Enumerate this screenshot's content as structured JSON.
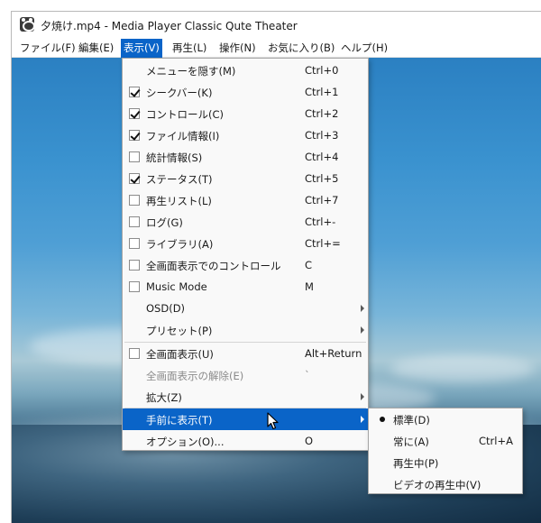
{
  "window": {
    "title": "夕焼け.mp4 - Media Player Classic Qute Theater"
  },
  "menubar": [
    {
      "label": "ファイル(F)",
      "name": "menu-file"
    },
    {
      "label": "編集(E)",
      "name": "menu-edit"
    },
    {
      "label": "表示(V)",
      "name": "menu-view"
    },
    {
      "label": "再生(L)",
      "name": "menu-play"
    },
    {
      "label": "操作(N)",
      "name": "menu-navigate"
    },
    {
      "label": "お気に入り(B)",
      "name": "menu-favorites"
    },
    {
      "label": "ヘルプ(H)",
      "name": "menu-help"
    }
  ],
  "view_menu": {
    "items": [
      {
        "label": "メニューを隠す(M)",
        "shortcut": "Ctrl+0"
      },
      {
        "label": "シークバー(K)",
        "shortcut": "Ctrl+1",
        "checked": true
      },
      {
        "label": "コントロール(C)",
        "shortcut": "Ctrl+2",
        "checked": true
      },
      {
        "label": "ファイル情報(I)",
        "shortcut": "Ctrl+3",
        "checked": true
      },
      {
        "label": "統計情報(S)",
        "shortcut": "Ctrl+4",
        "checked": false
      },
      {
        "label": "ステータス(T)",
        "shortcut": "Ctrl+5",
        "checked": true
      },
      {
        "label": "再生リスト(L)",
        "shortcut": "Ctrl+7",
        "checked": false
      },
      {
        "label": "ログ(G)",
        "shortcut": "Ctrl+-",
        "checked": false
      },
      {
        "label": "ライブラリ(A)",
        "shortcut": "Ctrl+=",
        "checked": false
      },
      {
        "label": "全画面表示でのコントロール",
        "shortcut": "C",
        "checked": false
      },
      {
        "label": "Music Mode",
        "shortcut": "M",
        "checked": false
      },
      {
        "label": "OSD(D)",
        "shortcut": ""
      },
      {
        "label": "プリセット(P)",
        "shortcut": ""
      },
      {
        "label": "全画面表示(U)",
        "shortcut": "Alt+Return",
        "checked": false
      },
      {
        "label": "全画面表示の解除(E)",
        "shortcut": "`",
        "disabled": true
      },
      {
        "label": "拡大(Z)",
        "shortcut": ""
      },
      {
        "label": "手前に表示(T)",
        "shortcut": "",
        "highlighted": true
      },
      {
        "label": "オプション(O)...",
        "shortcut": "O"
      }
    ]
  },
  "ontop_submenu": {
    "items": [
      {
        "label": "標準(D)",
        "shortcut": "",
        "selected": true
      },
      {
        "label": "常に(A)",
        "shortcut": "Ctrl+A"
      },
      {
        "label": "再生中(P)",
        "shortcut": ""
      },
      {
        "label": "ビデオの再生中(V)",
        "shortcut": ""
      }
    ]
  },
  "colors": {
    "highlight": "#0a64c8",
    "menu_bg": "#f9f9f9"
  },
  "icons": {
    "app": "mpc-qt-app-icon",
    "check": "checkmark-icon",
    "submenu": "chevron-right-icon",
    "radio": "radio-bullet-icon",
    "cursor": "mouse-pointer-icon"
  }
}
